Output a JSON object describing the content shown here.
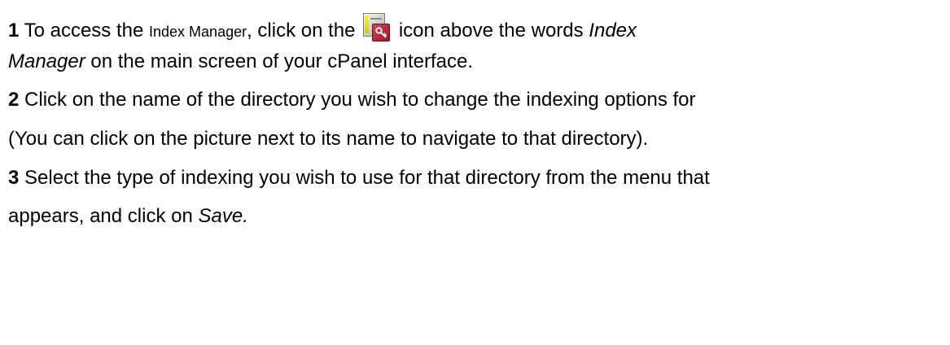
{
  "steps": [
    {
      "number": "1",
      "text_a": " To access the ",
      "text_b": "Index Manager",
      "text_c": ", click on the ",
      "text_d": " icon above the words ",
      "emphasis_1": "Index",
      "emphasis_2": "Manager",
      "text_e": " on the main screen of your cPanel interface.",
      "icon": "index-manager-icon"
    },
    {
      "number": "2",
      "text_a": " Click on the name of the directory you wish to change the indexing options for",
      "text_b": "(You can click on the picture next to its name to navigate to that directory)."
    },
    {
      "number": "3",
      "text_a": " Select the type of indexing you wish to use for that directory from the menu that",
      "text_b": "appears, and click on ",
      "emphasis": "Save."
    }
  ],
  "colors": {
    "text": "#000000",
    "background": "#ffffff",
    "icon_badge": "#b3263a",
    "icon_bar": "#e8e23c"
  }
}
